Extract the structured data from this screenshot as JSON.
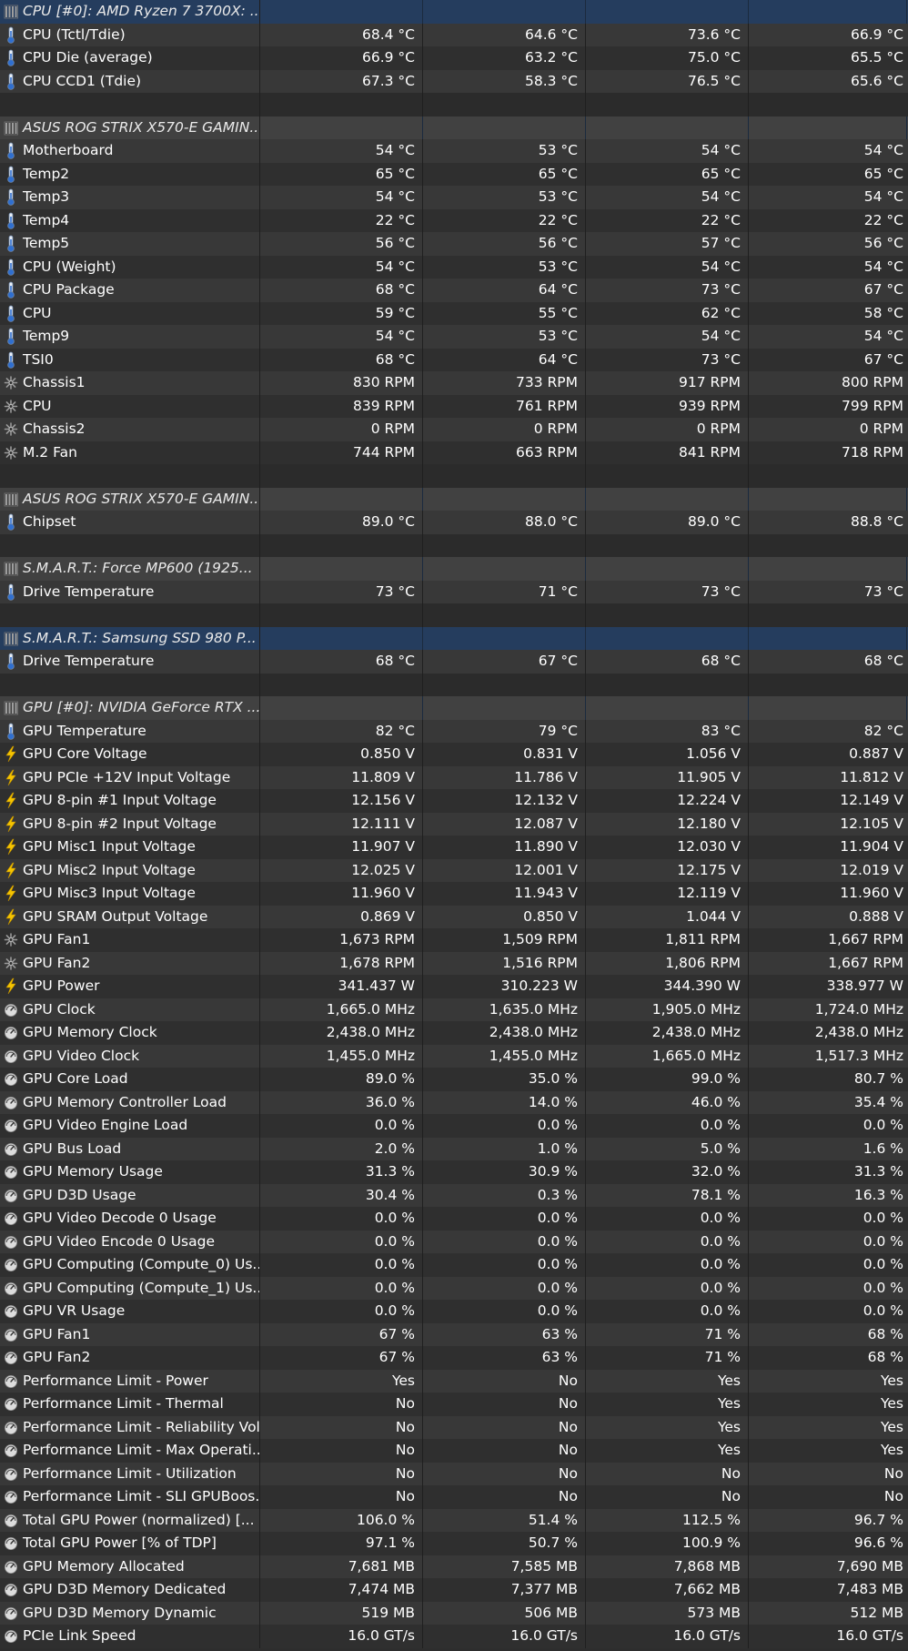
{
  "sections": [
    {
      "header": "CPU [#0]: AMD Ryzen 7 3700X: ...",
      "selected": true,
      "rows": [
        {
          "icon": "thermometer-icon",
          "label": "CPU (Tctl/Tdie)",
          "values": [
            "68.4 °C",
            "64.6 °C",
            "73.6 °C",
            "66.9 °C"
          ]
        },
        {
          "icon": "thermometer-icon",
          "label": "CPU Die (average)",
          "values": [
            "66.9 °C",
            "63.2 °C",
            "75.0 °C",
            "65.5 °C"
          ]
        },
        {
          "icon": "thermometer-icon",
          "label": "CPU CCD1 (Tdie)",
          "values": [
            "67.3 °C",
            "58.3 °C",
            "76.5 °C",
            "65.6 °C"
          ]
        }
      ]
    },
    {
      "header": "ASUS ROG STRIX X570-E GAMIN...",
      "rows": [
        {
          "icon": "thermometer-icon",
          "label": "Motherboard",
          "values": [
            "54 °C",
            "53 °C",
            "54 °C",
            "54 °C"
          ]
        },
        {
          "icon": "thermometer-icon",
          "label": "Temp2",
          "values": [
            "65 °C",
            "65 °C",
            "65 °C",
            "65 °C"
          ]
        },
        {
          "icon": "thermometer-icon",
          "label": "Temp3",
          "values": [
            "54 °C",
            "53 °C",
            "54 °C",
            "54 °C"
          ]
        },
        {
          "icon": "thermometer-icon",
          "label": "Temp4",
          "values": [
            "22 °C",
            "22 °C",
            "22 °C",
            "22 °C"
          ]
        },
        {
          "icon": "thermometer-icon",
          "label": "Temp5",
          "values": [
            "56 °C",
            "56 °C",
            "57 °C",
            "56 °C"
          ]
        },
        {
          "icon": "thermometer-icon",
          "label": "CPU (Weight)",
          "values": [
            "54 °C",
            "53 °C",
            "54 °C",
            "54 °C"
          ]
        },
        {
          "icon": "thermometer-icon",
          "label": "CPU Package",
          "values": [
            "68 °C",
            "64 °C",
            "73 °C",
            "67 °C"
          ]
        },
        {
          "icon": "thermometer-icon",
          "label": "CPU",
          "values": [
            "59 °C",
            "55 °C",
            "62 °C",
            "58 °C"
          ]
        },
        {
          "icon": "thermometer-icon",
          "label": "Temp9",
          "values": [
            "54 °C",
            "53 °C",
            "54 °C",
            "54 °C"
          ]
        },
        {
          "icon": "thermometer-icon",
          "label": "TSI0",
          "values": [
            "68 °C",
            "64 °C",
            "73 °C",
            "67 °C"
          ]
        },
        {
          "icon": "fan-icon",
          "label": "Chassis1",
          "values": [
            "830 RPM",
            "733 RPM",
            "917 RPM",
            "800 RPM"
          ]
        },
        {
          "icon": "fan-icon",
          "label": "CPU",
          "values": [
            "839 RPM",
            "761 RPM",
            "939 RPM",
            "799 RPM"
          ]
        },
        {
          "icon": "fan-icon",
          "label": "Chassis2",
          "values": [
            "0 RPM",
            "0 RPM",
            "0 RPM",
            "0 RPM"
          ]
        },
        {
          "icon": "fan-icon",
          "label": "M.2 Fan",
          "values": [
            "744 RPM",
            "663 RPM",
            "841 RPM",
            "718 RPM"
          ]
        }
      ]
    },
    {
      "header": "ASUS ROG STRIX X570-E GAMIN...",
      "rows": [
        {
          "icon": "thermometer-icon",
          "label": "Chipset",
          "values": [
            "89.0 °C",
            "88.0 °C",
            "89.0 °C",
            "88.8 °C"
          ]
        }
      ]
    },
    {
      "header": "S.M.A.R.T.: Force MP600 (1925...",
      "rows": [
        {
          "icon": "thermometer-icon",
          "label": "Drive Temperature",
          "values": [
            "73 °C",
            "71 °C",
            "73 °C",
            "73 °C"
          ]
        }
      ]
    },
    {
      "header": "S.M.A.R.T.: Samsung SSD 980 P...",
      "selected": true,
      "rows": [
        {
          "icon": "thermometer-icon",
          "label": "Drive Temperature",
          "values": [
            "68 °C",
            "67 °C",
            "68 °C",
            "68 °C"
          ]
        }
      ]
    },
    {
      "header": "GPU [#0]: NVIDIA GeForce RTX ...",
      "rows": [
        {
          "icon": "thermometer-icon",
          "label": "GPU Temperature",
          "values": [
            "82 °C",
            "79 °C",
            "83 °C",
            "82 °C"
          ]
        },
        {
          "icon": "lightning-icon",
          "label": "GPU Core Voltage",
          "values": [
            "0.850 V",
            "0.831 V",
            "1.056 V",
            "0.887 V"
          ]
        },
        {
          "icon": "lightning-icon",
          "label": "GPU PCIe +12V Input Voltage",
          "values": [
            "11.809 V",
            "11.786 V",
            "11.905 V",
            "11.812 V"
          ]
        },
        {
          "icon": "lightning-icon",
          "label": "GPU 8-pin #1 Input Voltage",
          "values": [
            "12.156 V",
            "12.132 V",
            "12.224 V",
            "12.149 V"
          ]
        },
        {
          "icon": "lightning-icon",
          "label": "GPU 8-pin #2 Input Voltage",
          "values": [
            "12.111 V",
            "12.087 V",
            "12.180 V",
            "12.105 V"
          ]
        },
        {
          "icon": "lightning-icon",
          "label": "GPU Misc1 Input Voltage",
          "values": [
            "11.907 V",
            "11.890 V",
            "12.030 V",
            "11.904 V"
          ]
        },
        {
          "icon": "lightning-icon",
          "label": "GPU Misc2 Input Voltage",
          "values": [
            "12.025 V",
            "12.001 V",
            "12.175 V",
            "12.019 V"
          ]
        },
        {
          "icon": "lightning-icon",
          "label": "GPU Misc3 Input Voltage",
          "values": [
            "11.960 V",
            "11.943 V",
            "12.119 V",
            "11.960 V"
          ]
        },
        {
          "icon": "lightning-icon",
          "label": "GPU SRAM Output Voltage",
          "values": [
            "0.869 V",
            "0.850 V",
            "1.044 V",
            "0.888 V"
          ]
        },
        {
          "icon": "fan-icon",
          "label": "GPU Fan1",
          "values": [
            "1,673 RPM",
            "1,509 RPM",
            "1,811 RPM",
            "1,667 RPM"
          ]
        },
        {
          "icon": "fan-icon",
          "label": "GPU Fan2",
          "values": [
            "1,678 RPM",
            "1,516 RPM",
            "1,806 RPM",
            "1,667 RPM"
          ]
        },
        {
          "icon": "lightning-icon",
          "label": "GPU Power",
          "values": [
            "341.437 W",
            "310.223 W",
            "344.390 W",
            "338.977 W"
          ]
        },
        {
          "icon": "gauge-icon",
          "label": "GPU Clock",
          "values": [
            "1,665.0 MHz",
            "1,635.0 MHz",
            "1,905.0 MHz",
            "1,724.0 MHz"
          ]
        },
        {
          "icon": "gauge-icon",
          "label": "GPU Memory Clock",
          "values": [
            "2,438.0 MHz",
            "2,438.0 MHz",
            "2,438.0 MHz",
            "2,438.0 MHz"
          ]
        },
        {
          "icon": "gauge-icon",
          "label": "GPU Video Clock",
          "values": [
            "1,455.0 MHz",
            "1,455.0 MHz",
            "1,665.0 MHz",
            "1,517.3 MHz"
          ]
        },
        {
          "icon": "gauge-icon",
          "label": "GPU Core Load",
          "values": [
            "89.0 %",
            "35.0 %",
            "99.0 %",
            "80.7 %"
          ]
        },
        {
          "icon": "gauge-icon",
          "label": "GPU Memory Controller Load",
          "values": [
            "36.0 %",
            "14.0 %",
            "46.0 %",
            "35.4 %"
          ]
        },
        {
          "icon": "gauge-icon",
          "label": "GPU Video Engine Load",
          "values": [
            "0.0 %",
            "0.0 %",
            "0.0 %",
            "0.0 %"
          ]
        },
        {
          "icon": "gauge-icon",
          "label": "GPU Bus Load",
          "values": [
            "2.0 %",
            "1.0 %",
            "5.0 %",
            "1.6 %"
          ]
        },
        {
          "icon": "gauge-icon",
          "label": "GPU Memory Usage",
          "values": [
            "31.3 %",
            "30.9 %",
            "32.0 %",
            "31.3 %"
          ]
        },
        {
          "icon": "gauge-icon",
          "label": "GPU D3D Usage",
          "values": [
            "30.4 %",
            "0.3 %",
            "78.1 %",
            "16.3 %"
          ]
        },
        {
          "icon": "gauge-icon",
          "label": "GPU Video Decode 0 Usage",
          "values": [
            "0.0 %",
            "0.0 %",
            "0.0 %",
            "0.0 %"
          ]
        },
        {
          "icon": "gauge-icon",
          "label": "GPU Video Encode 0 Usage",
          "values": [
            "0.0 %",
            "0.0 %",
            "0.0 %",
            "0.0 %"
          ]
        },
        {
          "icon": "gauge-icon",
          "label": "GPU Computing (Compute_0) Us...",
          "values": [
            "0.0 %",
            "0.0 %",
            "0.0 %",
            "0.0 %"
          ]
        },
        {
          "icon": "gauge-icon",
          "label": "GPU Computing (Compute_1) Us...",
          "values": [
            "0.0 %",
            "0.0 %",
            "0.0 %",
            "0.0 %"
          ]
        },
        {
          "icon": "gauge-icon",
          "label": "GPU VR Usage",
          "values": [
            "0.0 %",
            "0.0 %",
            "0.0 %",
            "0.0 %"
          ]
        },
        {
          "icon": "gauge-icon",
          "label": "GPU Fan1",
          "values": [
            "67 %",
            "63 %",
            "71 %",
            "68 %"
          ]
        },
        {
          "icon": "gauge-icon",
          "label": "GPU Fan2",
          "values": [
            "67 %",
            "63 %",
            "71 %",
            "68 %"
          ]
        },
        {
          "icon": "gauge-icon",
          "label": "Performance Limit - Power",
          "values": [
            "Yes",
            "No",
            "Yes",
            "Yes"
          ]
        },
        {
          "icon": "gauge-icon",
          "label": "Performance Limit - Thermal",
          "values": [
            "No",
            "No",
            "Yes",
            "Yes"
          ]
        },
        {
          "icon": "gauge-icon",
          "label": "Performance Limit - Reliability Vol...",
          "values": [
            "No",
            "No",
            "Yes",
            "Yes"
          ]
        },
        {
          "icon": "gauge-icon",
          "label": "Performance Limit - Max Operati...",
          "values": [
            "No",
            "No",
            "Yes",
            "Yes"
          ]
        },
        {
          "icon": "gauge-icon",
          "label": "Performance Limit - Utilization",
          "values": [
            "No",
            "No",
            "No",
            "No"
          ]
        },
        {
          "icon": "gauge-icon",
          "label": "Performance Limit - SLI GPUBoos...",
          "values": [
            "No",
            "No",
            "No",
            "No"
          ]
        },
        {
          "icon": "gauge-icon",
          "label": "Total GPU Power (normalized) [...",
          "values": [
            "106.0 %",
            "51.4 %",
            "112.5 %",
            "96.7 %"
          ]
        },
        {
          "icon": "gauge-icon",
          "label": "Total GPU Power [% of TDP]",
          "values": [
            "97.1 %",
            "50.7 %",
            "100.9 %",
            "96.6 %"
          ]
        },
        {
          "icon": "gauge-icon",
          "label": "GPU Memory Allocated",
          "values": [
            "7,681 MB",
            "7,585 MB",
            "7,868 MB",
            "7,690 MB"
          ]
        },
        {
          "icon": "gauge-icon",
          "label": "GPU D3D Memory Dedicated",
          "values": [
            "7,474 MB",
            "7,377 MB",
            "7,662 MB",
            "7,483 MB"
          ]
        },
        {
          "icon": "gauge-icon",
          "label": "GPU D3D Memory Dynamic",
          "values": [
            "519 MB",
            "506 MB",
            "573 MB",
            "512 MB"
          ]
        },
        {
          "icon": "gauge-icon",
          "label": "PCIe Link Speed",
          "values": [
            "16.0 GT/s",
            "16.0 GT/s",
            "16.0 GT/s",
            "16.0 GT/s"
          ]
        }
      ]
    }
  ]
}
